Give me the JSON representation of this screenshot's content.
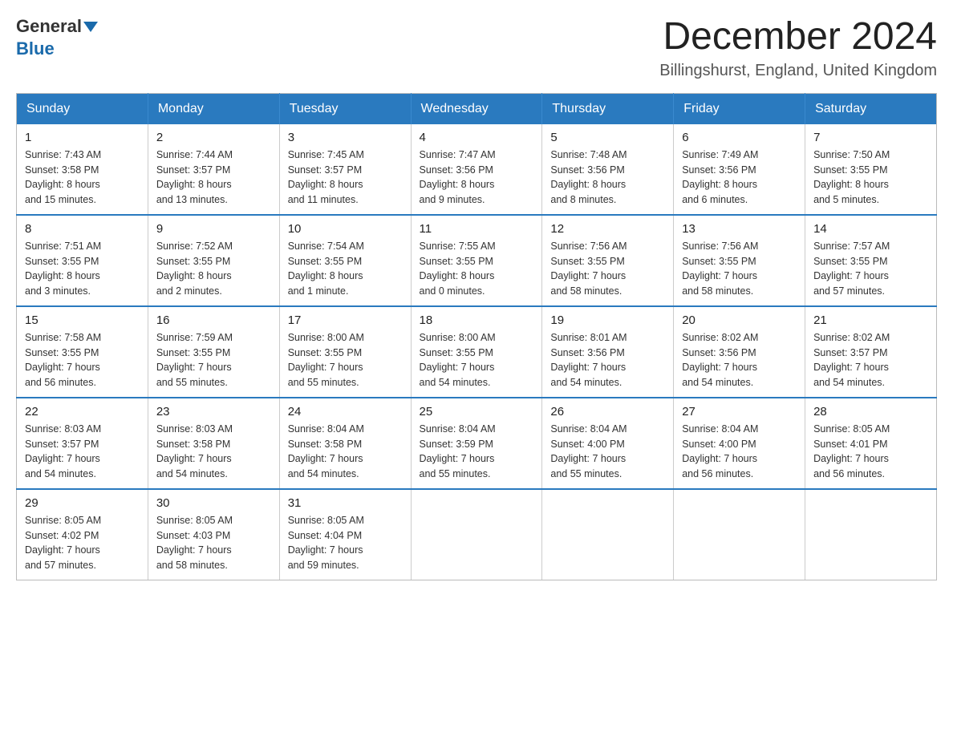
{
  "header": {
    "logo_general": "General",
    "logo_blue": "Blue",
    "title": "December 2024",
    "location": "Billingshurst, England, United Kingdom"
  },
  "calendar": {
    "days_of_week": [
      "Sunday",
      "Monday",
      "Tuesday",
      "Wednesday",
      "Thursday",
      "Friday",
      "Saturday"
    ],
    "weeks": [
      [
        {
          "day": "1",
          "info": "Sunrise: 7:43 AM\nSunset: 3:58 PM\nDaylight: 8 hours\nand 15 minutes."
        },
        {
          "day": "2",
          "info": "Sunrise: 7:44 AM\nSunset: 3:57 PM\nDaylight: 8 hours\nand 13 minutes."
        },
        {
          "day": "3",
          "info": "Sunrise: 7:45 AM\nSunset: 3:57 PM\nDaylight: 8 hours\nand 11 minutes."
        },
        {
          "day": "4",
          "info": "Sunrise: 7:47 AM\nSunset: 3:56 PM\nDaylight: 8 hours\nand 9 minutes."
        },
        {
          "day": "5",
          "info": "Sunrise: 7:48 AM\nSunset: 3:56 PM\nDaylight: 8 hours\nand 8 minutes."
        },
        {
          "day": "6",
          "info": "Sunrise: 7:49 AM\nSunset: 3:56 PM\nDaylight: 8 hours\nand 6 minutes."
        },
        {
          "day": "7",
          "info": "Sunrise: 7:50 AM\nSunset: 3:55 PM\nDaylight: 8 hours\nand 5 minutes."
        }
      ],
      [
        {
          "day": "8",
          "info": "Sunrise: 7:51 AM\nSunset: 3:55 PM\nDaylight: 8 hours\nand 3 minutes."
        },
        {
          "day": "9",
          "info": "Sunrise: 7:52 AM\nSunset: 3:55 PM\nDaylight: 8 hours\nand 2 minutes."
        },
        {
          "day": "10",
          "info": "Sunrise: 7:54 AM\nSunset: 3:55 PM\nDaylight: 8 hours\nand 1 minute."
        },
        {
          "day": "11",
          "info": "Sunrise: 7:55 AM\nSunset: 3:55 PM\nDaylight: 8 hours\nand 0 minutes."
        },
        {
          "day": "12",
          "info": "Sunrise: 7:56 AM\nSunset: 3:55 PM\nDaylight: 7 hours\nand 58 minutes."
        },
        {
          "day": "13",
          "info": "Sunrise: 7:56 AM\nSunset: 3:55 PM\nDaylight: 7 hours\nand 58 minutes."
        },
        {
          "day": "14",
          "info": "Sunrise: 7:57 AM\nSunset: 3:55 PM\nDaylight: 7 hours\nand 57 minutes."
        }
      ],
      [
        {
          "day": "15",
          "info": "Sunrise: 7:58 AM\nSunset: 3:55 PM\nDaylight: 7 hours\nand 56 minutes."
        },
        {
          "day": "16",
          "info": "Sunrise: 7:59 AM\nSunset: 3:55 PM\nDaylight: 7 hours\nand 55 minutes."
        },
        {
          "day": "17",
          "info": "Sunrise: 8:00 AM\nSunset: 3:55 PM\nDaylight: 7 hours\nand 55 minutes."
        },
        {
          "day": "18",
          "info": "Sunrise: 8:00 AM\nSunset: 3:55 PM\nDaylight: 7 hours\nand 54 minutes."
        },
        {
          "day": "19",
          "info": "Sunrise: 8:01 AM\nSunset: 3:56 PM\nDaylight: 7 hours\nand 54 minutes."
        },
        {
          "day": "20",
          "info": "Sunrise: 8:02 AM\nSunset: 3:56 PM\nDaylight: 7 hours\nand 54 minutes."
        },
        {
          "day": "21",
          "info": "Sunrise: 8:02 AM\nSunset: 3:57 PM\nDaylight: 7 hours\nand 54 minutes."
        }
      ],
      [
        {
          "day": "22",
          "info": "Sunrise: 8:03 AM\nSunset: 3:57 PM\nDaylight: 7 hours\nand 54 minutes."
        },
        {
          "day": "23",
          "info": "Sunrise: 8:03 AM\nSunset: 3:58 PM\nDaylight: 7 hours\nand 54 minutes."
        },
        {
          "day": "24",
          "info": "Sunrise: 8:04 AM\nSunset: 3:58 PM\nDaylight: 7 hours\nand 54 minutes."
        },
        {
          "day": "25",
          "info": "Sunrise: 8:04 AM\nSunset: 3:59 PM\nDaylight: 7 hours\nand 55 minutes."
        },
        {
          "day": "26",
          "info": "Sunrise: 8:04 AM\nSunset: 4:00 PM\nDaylight: 7 hours\nand 55 minutes."
        },
        {
          "day": "27",
          "info": "Sunrise: 8:04 AM\nSunset: 4:00 PM\nDaylight: 7 hours\nand 56 minutes."
        },
        {
          "day": "28",
          "info": "Sunrise: 8:05 AM\nSunset: 4:01 PM\nDaylight: 7 hours\nand 56 minutes."
        }
      ],
      [
        {
          "day": "29",
          "info": "Sunrise: 8:05 AM\nSunset: 4:02 PM\nDaylight: 7 hours\nand 57 minutes."
        },
        {
          "day": "30",
          "info": "Sunrise: 8:05 AM\nSunset: 4:03 PM\nDaylight: 7 hours\nand 58 minutes."
        },
        {
          "day": "31",
          "info": "Sunrise: 8:05 AM\nSunset: 4:04 PM\nDaylight: 7 hours\nand 59 minutes."
        },
        {
          "day": "",
          "info": ""
        },
        {
          "day": "",
          "info": ""
        },
        {
          "day": "",
          "info": ""
        },
        {
          "day": "",
          "info": ""
        }
      ]
    ]
  }
}
